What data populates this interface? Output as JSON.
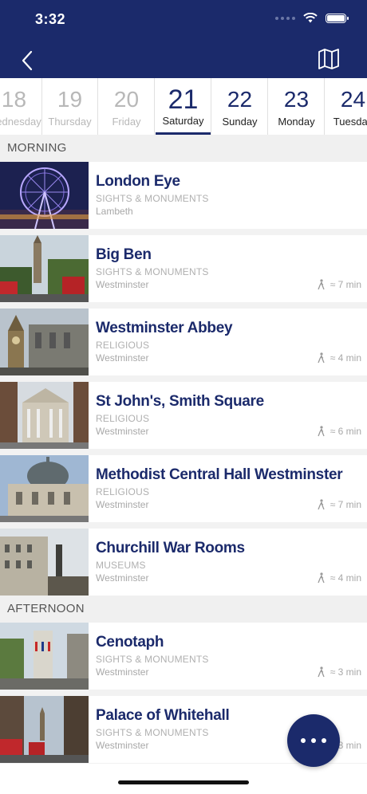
{
  "status": {
    "time": "3:32"
  },
  "header": {
    "back_icon": "chevron-left-icon",
    "map_icon": "map-icon"
  },
  "days": [
    {
      "num": "18",
      "name": "Wednesday",
      "state": "past"
    },
    {
      "num": "19",
      "name": "Thursday",
      "state": "past"
    },
    {
      "num": "20",
      "name": "Friday",
      "state": "past"
    },
    {
      "num": "21",
      "name": "Saturday",
      "state": "active"
    },
    {
      "num": "22",
      "name": "Sunday",
      "state": "future"
    },
    {
      "num": "23",
      "name": "Monday",
      "state": "future"
    },
    {
      "num": "24",
      "name": "Tuesday",
      "state": "future"
    }
  ],
  "sections": {
    "morning": "MORNING",
    "afternoon": "AFTERNOON"
  },
  "places": [
    {
      "title": "London Eye",
      "category": "SIGHTS & MONUMENTS",
      "area": "Lambeth",
      "walk": ""
    },
    {
      "title": "Big Ben",
      "category": "SIGHTS & MONUMENTS",
      "area": "Westminster",
      "walk": "≈ 7 min"
    },
    {
      "title": "Westminster Abbey",
      "category": "RELIGIOUS",
      "area": "Westminster",
      "walk": "≈ 4 min"
    },
    {
      "title": "St John's, Smith Square",
      "category": "RELIGIOUS",
      "area": "Westminster",
      "walk": "≈ 6 min"
    },
    {
      "title": "Methodist Central Hall Westminster",
      "category": "RELIGIOUS",
      "area": "Westminster",
      "walk": "≈ 7 min"
    },
    {
      "title": "Churchill War Rooms",
      "category": "MUSEUMS",
      "area": "Westminster",
      "walk": "≈ 4 min"
    },
    {
      "title": "Cenotaph",
      "category": "SIGHTS & MONUMENTS",
      "area": "Westminster",
      "walk": "≈ 3 min"
    },
    {
      "title": "Palace of Whitehall",
      "category": "SIGHTS & MONUMENTS",
      "area": "Westminster",
      "walk": "8 min"
    }
  ],
  "colors": {
    "brand": "#1b2a6b",
    "muted": "#b0b0b0"
  }
}
